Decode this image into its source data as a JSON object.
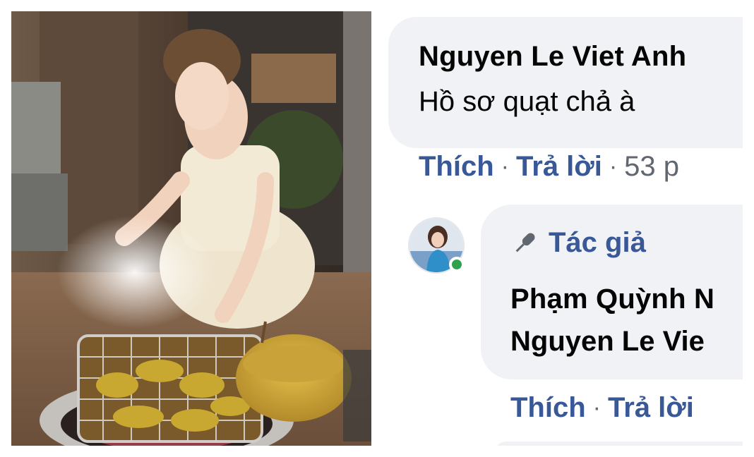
{
  "comments": [
    {
      "author": "Nguyen Le Viet Anh",
      "text": "Hồ sơ quạt chả à",
      "like_label": "Thích",
      "reply_label": "Trả lời",
      "separator": "·",
      "time": "53 p"
    },
    {
      "badge_label": "Tác giả",
      "badge_icon": "microphone-icon",
      "author": "Phạm Quỳnh N",
      "text": "Nguyen Le Vie",
      "like_label": "Thích",
      "reply_label": "Trả lời",
      "separator": "·",
      "online": true
    }
  ],
  "colors": {
    "link_blue": "#385898",
    "bubble_bg": "#f0f2f5",
    "text_dark": "#050505",
    "meta_gray": "#606770",
    "online_green": "#31a24c"
  }
}
